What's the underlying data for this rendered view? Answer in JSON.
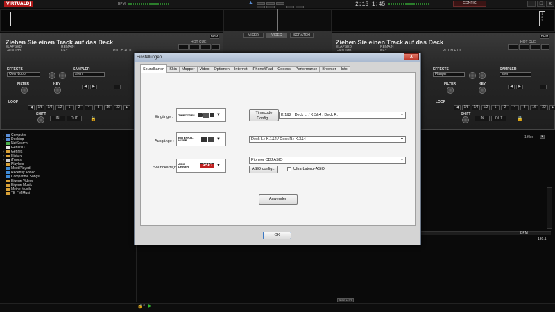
{
  "topbar": {
    "logo": "VIRTUALDJ",
    "bpm_label": "BPM",
    "clock": "2:15 1:45",
    "config_label": "CONFIG",
    "win_min": "_",
    "win_close": "x"
  },
  "decks": {
    "left": {
      "title": "Ziehen Sie einen Track auf das Deck",
      "elapsed": "ELAPSED",
      "remain": "REMAIN",
      "gain": "GAIN 0dB",
      "key": "KEY",
      "pitch": "PITCH +0.0",
      "hot_cue": "HOT CUE",
      "bpm_btn": "BPM",
      "effects": "EFFECTS",
      "effect_value": "Over-Loop",
      "sampler": "SAMPLER",
      "sampler_value": "siren",
      "filter": "FILTER",
      "key_knob": "KEY",
      "loop": "LOOP",
      "loop_values": [
        "1/8",
        "1/4",
        "1/2",
        "1",
        "2",
        "4",
        "8",
        "16",
        "32"
      ],
      "shift": "SHIFT",
      "in": "IN",
      "out": "OUT"
    },
    "right": {
      "title": "Ziehen Sie einen Track auf das Deck",
      "elapsed": "ELAPSED",
      "remain": "REMAIN",
      "gain": "GAIN 0dB",
      "key": "KEY",
      "pitch": "PITCH +0.0",
      "hot_cue": "HOT CUE",
      "bpm_btn": "BPM",
      "effects": "EFFECTS",
      "effect_value": "Flanger",
      "sampler": "SAMPLER",
      "sampler_value": "siren",
      "filter": "FILTER",
      "key_knob": "KEY",
      "loop": "LOOP",
      "loop_values": [
        "1/8",
        "1/4",
        "1/2",
        "1",
        "2",
        "4",
        "8",
        "16",
        "32"
      ],
      "shift": "SHIFT",
      "in": "IN",
      "out": "OUT"
    }
  },
  "mixer": {
    "tabs": [
      "MIXER",
      "VIDEO",
      "SCRATCH"
    ]
  },
  "browser": {
    "folders": [
      {
        "label": "Computer",
        "icon": "computer-icon",
        "color": "#5a8ed6"
      },
      {
        "label": "Desktop",
        "icon": "desktop-icon",
        "color": "#5a8ed6"
      },
      {
        "label": "NetSearch",
        "icon": "search-icon",
        "color": "#4bb04b"
      },
      {
        "label": "GeniusDJ",
        "icon": "genius-icon",
        "color": "#e6e6e6"
      },
      {
        "label": "Genres",
        "icon": "genres-icon",
        "color": "#d7a037"
      },
      {
        "label": "History",
        "icon": "history-icon",
        "color": "#d7a037"
      },
      {
        "label": "iTunes",
        "icon": "itunes-icon",
        "color": "#cfcfcf"
      },
      {
        "label": "Playlists",
        "icon": "playlists-icon",
        "color": "#d7a037"
      },
      {
        "label": "Most Played",
        "icon": "filter-folder-icon",
        "color": "#3e8bd6"
      },
      {
        "label": "Recently Added",
        "icon": "filter-folder-icon",
        "color": "#3e8bd6"
      },
      {
        "label": "Compatible Songs",
        "icon": "filter-folder-icon",
        "color": "#3e8bd6"
      },
      {
        "label": "Eigene Videos",
        "icon": "folder-icon",
        "color": "#d7a037"
      },
      {
        "label": "Eigene Musik",
        "icon": "folder-icon",
        "color": "#d7a037"
      },
      {
        "label": "Meine Musik",
        "icon": "folder-icon",
        "color": "#d7a037"
      },
      {
        "label": "TB FM Musi",
        "icon": "folder-icon",
        "color": "#d7a037"
      }
    ],
    "files_count": "1 files",
    "list_header_bpm": "BPM",
    "list_value": "130.1",
    "side_list_btn": "SIDE LIST",
    "sidebar_label": "SIDEVIEW"
  },
  "dialog": {
    "title": "Einstellungen",
    "close": "x",
    "tabs": [
      "Soundkarten",
      "Skin",
      "Mapper",
      "Video",
      "Optionen",
      "Internet",
      "iPhone/iPad",
      "Codecs",
      "Performance",
      "Browser",
      "Info"
    ],
    "active_tab": "Soundkarten",
    "inputs_label": "Eingänge :",
    "inputs_image": "TIMECODES",
    "timecode_btn": "Timecode Config...",
    "inputs_select": "K.1&2 : Deck L. / K.3&4 : Deck R.",
    "outputs_label": "Ausgänge :",
    "outputs_image": "EXTERNAL MIXER",
    "outputs_select": "Deck L.: K.1&2 / Deck R.: K.3&4",
    "card_label": "Soundkarte(n) :",
    "card_image": "ASIO DRIVER",
    "card_select": "Pioneer CDJ ASIO",
    "asio_btn": "ASIO config...",
    "ultra_label": "Ultra-Latenz-ASIO",
    "ultra_checked": false,
    "apply_btn": "Anwenden",
    "ok_btn": "OK"
  }
}
